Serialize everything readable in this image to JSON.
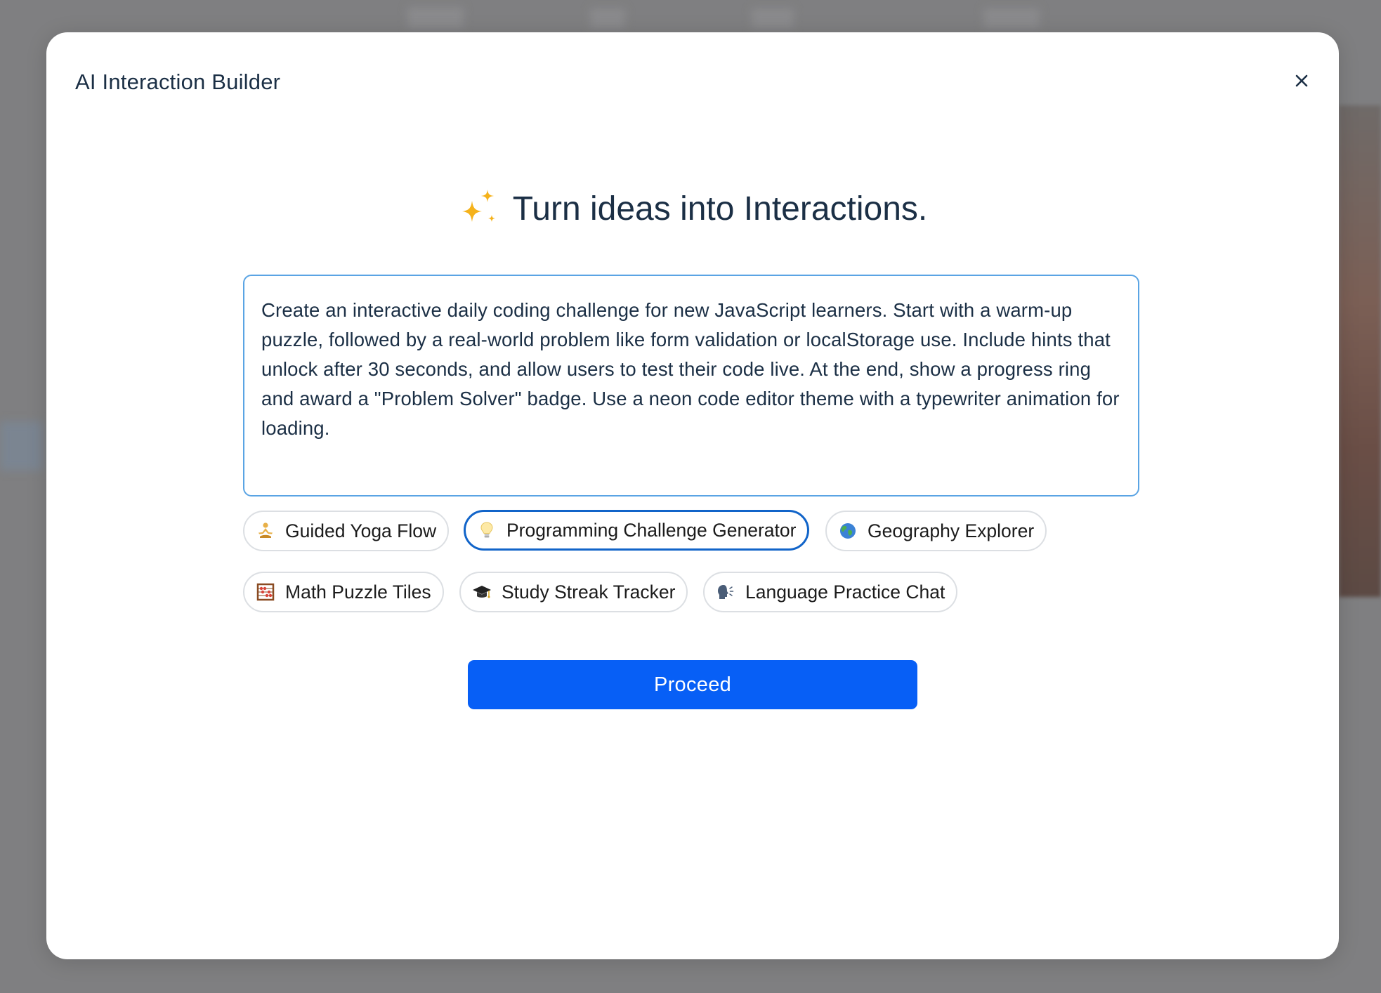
{
  "modal": {
    "title": "AI Interaction Builder",
    "close_icon": "close-icon"
  },
  "hero": {
    "icon": "sparkles-icon",
    "text": "Turn ideas into Interactions."
  },
  "prompt": {
    "value": "Create an interactive daily coding challenge for new JavaScript learners. Start with a warm-up puzzle, followed by a real-world problem like form validation or localStorage use. Include hints that unlock after 30 seconds, and allow users to test their code live. At the end, show a progress ring and award a \"Problem Solver\" badge. Use a neon code editor theme with a typewriter animation for loading."
  },
  "chips": [
    {
      "icon": "meditation-icon",
      "label": "Guided Yoga Flow",
      "selected": false
    },
    {
      "icon": "lightbulb-icon",
      "label": "Programming Challenge Generator",
      "selected": true
    },
    {
      "icon": "globe-icon",
      "label": "Geography Explorer",
      "selected": false
    },
    {
      "icon": "abacus-icon",
      "label": "Math Puzzle Tiles",
      "selected": false
    },
    {
      "icon": "graduation-cap-icon",
      "label": "Study Streak Tracker",
      "selected": false
    },
    {
      "icon": "speaking-head-icon",
      "label": "Language Practice Chat",
      "selected": false
    }
  ],
  "actions": {
    "proceed_label": "Proceed"
  },
  "colors": {
    "primary": "#075ff6",
    "selected_border": "#1164c9",
    "focus_border": "#5aa4e4",
    "text": "#1b2f45",
    "sparkle": "#f5b21b"
  }
}
